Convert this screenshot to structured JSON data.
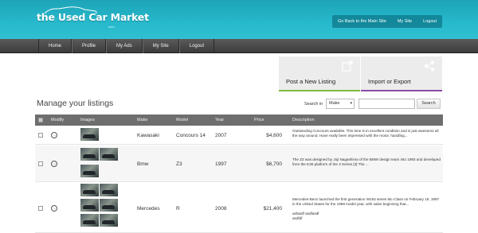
{
  "header": {
    "logo": "the Used Car Market",
    "logo_sub": ".com",
    "links": [
      "Go Back to the Main Site",
      "My Site",
      "Logout"
    ]
  },
  "nav": [
    "Home",
    "Profile",
    "My Ads",
    "My Site",
    "Logout"
  ],
  "tiles": {
    "post": "Post a New Listing",
    "import": "Import or Export"
  },
  "page_title": "Manage your listings",
  "search": {
    "label": "Search in",
    "selected": "Make",
    "button": "Search"
  },
  "table": {
    "headers": [
      "Modify",
      "Images",
      "Make",
      "Model",
      "Year",
      "Price",
      "Description"
    ],
    "rows": [
      {
        "make": "Kawasaki",
        "model": "Concours 14",
        "year": "2007",
        "price": "$4,600",
        "description": "Outstanding Concours available. This time is in excellent condition and is just awesome all the way around. Have really been impressed with the motor, handling..."
      },
      {
        "make": "Bmw",
        "model": "Z3",
        "year": "1997",
        "price": "$6,700",
        "description": "The Z3 was designed by Joji Nagashima of the BMW design team into 1993 and developed from the E36 platform of the 3 Series [3] The ..."
      },
      {
        "make": "Mercedes",
        "model": "R",
        "year": "2008",
        "price": "$21,400",
        "description": "Mercedes-Benz launched the first generation W163 series ML-Class on February 19, 1997 in the United States for the 1998 model year, with sales beginning that...",
        "extra1": "asfasdf asdfasdf",
        "extra2": "asdfdf"
      }
    ]
  },
  "colors": {
    "header": "#27b9cc",
    "nav": "#4a4a4a",
    "post_accent": "#7cbc3c",
    "import_accent": "#8a4aa8"
  }
}
